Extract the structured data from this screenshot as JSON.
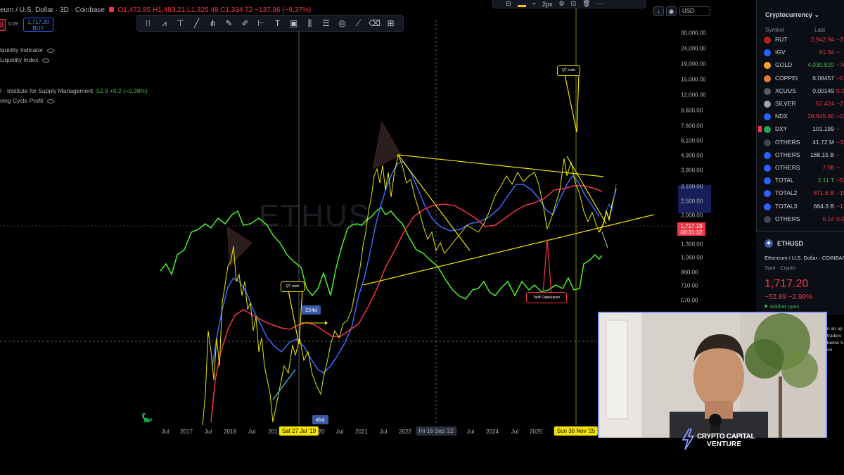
{
  "header": {
    "symbol_partial": "eum / U.S. Dollar · 3D · Coinbase",
    "open": "O1,472.85",
    "high": "H1,483.21",
    "low": "L1,325.48",
    "close": "C1,334.72",
    "change": "−137.96 (−9.37%)"
  },
  "trade": {
    "buy_price": "1,717.20",
    "buy_label": "BUY",
    "spread": "0.09"
  },
  "indicators": [
    {
      "name": "iquidity Indicator"
    },
    {
      "name": "Liquidity Index"
    },
    {
      "name": "I · Institute for Supply Management",
      "value": "52.9",
      "change": "+0.2 (+0.38%)"
    },
    {
      "name": "ving Cycle Profit"
    }
  ],
  "drawing_tools": [
    "pattern-tool",
    "fib-tool",
    "trendline-tool",
    "pitchfork-tool",
    "brush-tool",
    "pen-tool",
    "measure-tool",
    "text-tool",
    "frame-tool",
    "bars-tool",
    "lines-tool",
    "target-tool",
    "path-tool",
    "eraser-tool",
    "grid-tool"
  ],
  "top_toolbar": {
    "stroke_width": "2px"
  },
  "currency": "USD",
  "price_axis": [
    "30,000.00",
    "24,000.00",
    "19,000.00",
    "15,000.00",
    "12,000.00",
    "9,600.00",
    "7,600.00",
    "6,100.00",
    "4,900.00",
    "3,900.00",
    "3,100.00",
    "2,500.00",
    "2,000.00",
    "1,300.00",
    "1,060.00",
    "860.00",
    "710.00",
    "570.00"
  ],
  "current_price_tag": {
    "price": "1,717.18",
    "countdown": "08:31:32"
  },
  "time_axis": [
    "Jul",
    "2017",
    "Jul",
    "2018",
    "Jul",
    "201",
    "20",
    "Jul",
    "2021",
    "Jul",
    "2022",
    "Jul",
    "2024",
    "Jul",
    "2025"
  ],
  "time_badges": {
    "left": "Sat 27 Jul '19",
    "middle": "Fri 16 Sep '22",
    "right": "Sun 30 Nov '25"
  },
  "annotations": {
    "qt_ends_left": "QT ends",
    "qt_ends_right": "QT ends",
    "tariff": "Tariff Capitulation",
    "days_224": "224d",
    "days_45": "45d"
  },
  "watermark": "ETHUS",
  "watchlist": {
    "title": "Cryptocurrency",
    "col_symbol": "Symbol",
    "col_last": "Last",
    "rows": [
      {
        "symbol": "RUT",
        "last": "2,942.94",
        "change": "−3",
        "icon_color": "#b22222",
        "dir": "down"
      },
      {
        "symbol": "IGV",
        "last": "91.34",
        "change": "−",
        "icon_color": "#2962ff",
        "dir": "down"
      },
      {
        "symbol": "GOLD",
        "last": "4,030.820",
        "change": "−70",
        "icon_color": "#f5a623",
        "dir": "up"
      },
      {
        "symbol": "COPPEI",
        "last": "6.08457",
        "change": "−0.1",
        "icon_color": "#e8773a",
        "dir": "neutral"
      },
      {
        "symbol": "XCUUS",
        "last": "0.00149",
        "change": "0.00",
        "icon_color": "#555b66",
        "dir": "neutral"
      },
      {
        "symbol": "SILVER",
        "last": "57.424",
        "change": "−2",
        "icon_color": "#9ea3ad",
        "dir": "down"
      },
      {
        "symbol": "NDX",
        "last": "28,945.80",
        "change": "−22",
        "icon_color": "#2962ff",
        "dir": "down"
      },
      {
        "symbol": "DXY",
        "last": "101.199",
        "change": "−",
        "icon_color": "#22a65a",
        "dir": "neutral"
      },
      {
        "symbol": "OTHERS",
        "last": "41.72 M",
        "change": "−335",
        "icon_color": "#434651",
        "dir": "neutral"
      },
      {
        "symbol": "OTHERS",
        "last": "168.15 B",
        "change": "−",
        "icon_color": "#2962ff",
        "dir": "neutral"
      },
      {
        "symbol": "OTHERS",
        "last": "7.98",
        "change": "−",
        "icon_color": "#2962ff",
        "dir": "down"
      },
      {
        "symbol": "TOTAL",
        "last": "2.11 T",
        "change": "−53",
        "icon_color": "#2962ff",
        "dir": "up"
      },
      {
        "symbol": "TOTAL2",
        "last": "871.6 B",
        "change": "−19",
        "icon_color": "#2962ff",
        "dir": "down"
      },
      {
        "symbol": "TOTAL3",
        "last": "664.3 B",
        "change": "−13",
        "icon_color": "#2962ff",
        "dir": "neutral"
      },
      {
        "symbol": "OTHERS",
        "last": "0.14",
        "change": "0.00",
        "icon_color": "#434651",
        "dir": "down"
      }
    ]
  },
  "detail": {
    "symbol": "ETHUSD",
    "description": "Ethereum / U.S. Dollar · COINBASE",
    "type": "Spot · Crypto",
    "price": "1,717.20",
    "change": "−52.89  −2.99%",
    "market_status": "Market open"
  },
  "webcam_side_text": [
    "n an up",
    "traders",
    "below S",
    "on."
  ],
  "brand": {
    "line1": "CRYPTO CAPITAL",
    "line2": "VENTURE"
  },
  "colors": {
    "price_line": "#e5e800",
    "blue_ma": "#3d6bff",
    "red_ma": "#f23645",
    "green_indicator": "#4cf02b",
    "trendline": "#f5e400",
    "accent": "#2962ff"
  }
}
